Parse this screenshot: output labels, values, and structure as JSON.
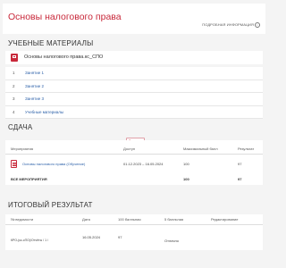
{
  "header": {
    "title": "Основы налогового права",
    "info_link": "ПОДРОБНАЯ ИНФОРМАЦИЯ"
  },
  "materials": {
    "heading": "УЧЕБНЫЕ МАТЕРИАЛЫ",
    "course_name": "Основы налогового права.кс_СПО",
    "items": [
      {
        "num": "1",
        "label": "Занятие 1"
      },
      {
        "num": "2",
        "label": "Занятие 2"
      },
      {
        "num": "3",
        "label": "Занятие 3"
      },
      {
        "num": "4",
        "label": "Учебные материалы"
      }
    ]
  },
  "submission": {
    "heading": "СДАЧА",
    "badge": "Текущие",
    "columns": {
      "event": "Мероприятия",
      "access": "Доступ",
      "max": "Максимальный балл",
      "result": "Результат"
    },
    "row": {
      "event": "Основы налогового права (Обучение)",
      "access": "01.12.2023 – 16.05.2024",
      "max": "100",
      "result": "97"
    },
    "total": {
      "label": "ВСЕ МЕРОПРИЯТИЯ",
      "max": "100",
      "result": "97"
    }
  },
  "final": {
    "heading": "ИТОГОВЫЙ РЕЗУЛЬТАТ",
    "columns": {
      "sheet": "№ ведомости",
      "date": "Дата",
      "score100": "100 балльная",
      "score5": "5 балльная",
      "edit": "Редактирование"
    },
    "row": {
      "sheet": "КРО-(кс-сПО)/Отчёты / 1 /",
      "date": "16.05.2024",
      "score100": "97",
      "score5": "Отлично"
    }
  }
}
